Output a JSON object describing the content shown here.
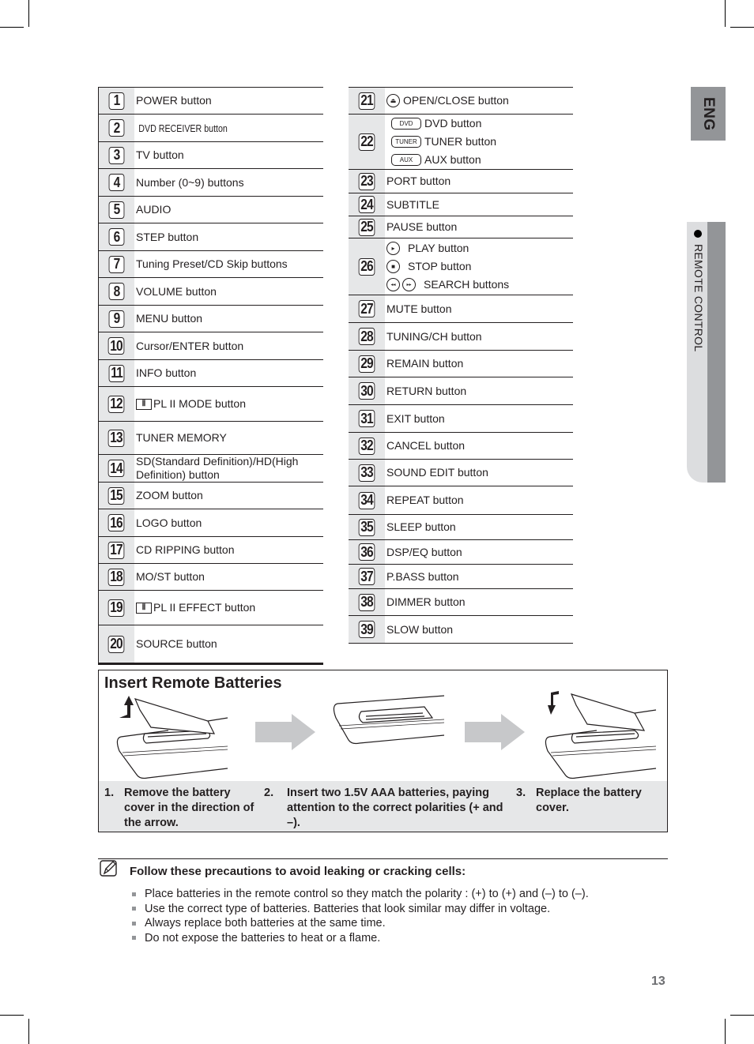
{
  "side_tabs": {
    "language": "ENG",
    "section": "REMOTE CONTROL"
  },
  "left_table": [
    {
      "num": "1",
      "label": "POWER button"
    },
    {
      "num": "2",
      "label": "DVD RECEIVER button",
      "narrow": true
    },
    {
      "num": "3",
      "label": "TV button"
    },
    {
      "num": "4",
      "label": "Number (0~9) buttons"
    },
    {
      "num": "5",
      "label": "AUDIO"
    },
    {
      "num": "6",
      "label": "STEP button"
    },
    {
      "num": "7",
      "label": "Tuning Preset/CD Skip buttons"
    },
    {
      "num": "8",
      "label": "VOLUME button"
    },
    {
      "num": "9",
      "label": "MENU button"
    },
    {
      "num": "10",
      "label": "Cursor/ENTER button"
    },
    {
      "num": "11",
      "label": "INFO button"
    },
    {
      "num": "12",
      "label": "PL II MODE button",
      "icon": "dolby-icon"
    },
    {
      "num": "13",
      "label": "TUNER MEMORY"
    },
    {
      "num": "14",
      "label": "SD(Standard Definition)/HD(High Definition) button"
    },
    {
      "num": "15",
      "label": "ZOOM button"
    },
    {
      "num": "16",
      "label": "LOGO button"
    },
    {
      "num": "17",
      "label": "CD RIPPING  button"
    },
    {
      "num": "18",
      "label": "MO/ST button"
    },
    {
      "num": "19",
      "label": "PL II EFFECT button",
      "icon": "dolby-icon"
    },
    {
      "num": "20",
      "label": "SOURCE button"
    }
  ],
  "right_table": [
    {
      "num": "21",
      "lines": [
        {
          "icon": "eject-icon",
          "label": "OPEN/CLOSE button"
        }
      ]
    },
    {
      "num": "22",
      "lines": [
        {
          "pill": "DVD",
          "label": "DVD button"
        },
        {
          "pill": "TUNER",
          "label": "TUNER button"
        },
        {
          "pill": "AUX",
          "label": "AUX button"
        }
      ]
    },
    {
      "num": "23",
      "lines": [
        {
          "label": "PORT button"
        }
      ]
    },
    {
      "num": "24",
      "lines": [
        {
          "label": "SUBTITLE"
        }
      ]
    },
    {
      "num": "25",
      "lines": [
        {
          "label": "PAUSE button"
        }
      ]
    },
    {
      "num": "26",
      "lines": [
        {
          "icon": "play-icon",
          "label": "PLAY button"
        },
        {
          "icon": "stop-icon",
          "label": "STOP button"
        },
        {
          "icon": "search-icons",
          "label": "SEARCH buttons"
        }
      ]
    },
    {
      "num": "27",
      "lines": [
        {
          "label": "MUTE button"
        }
      ]
    },
    {
      "num": "28",
      "lines": [
        {
          "label": "TUNING/CH button"
        }
      ]
    },
    {
      "num": "29",
      "lines": [
        {
          "label": "REMAIN button"
        }
      ]
    },
    {
      "num": "30",
      "lines": [
        {
          "label": "RETURN button"
        }
      ]
    },
    {
      "num": "31",
      "lines": [
        {
          "label": "EXIT button"
        }
      ]
    },
    {
      "num": "32",
      "lines": [
        {
          "label": "CANCEL button"
        }
      ]
    },
    {
      "num": "33",
      "lines": [
        {
          "label": "SOUND EDIT button"
        }
      ]
    },
    {
      "num": "34",
      "lines": [
        {
          "label": "REPEAT button"
        }
      ]
    },
    {
      "num": "35",
      "lines": [
        {
          "label": "SLEEP button"
        }
      ]
    },
    {
      "num": "36",
      "lines": [
        {
          "label": "DSP/EQ button"
        }
      ]
    },
    {
      "num": "37",
      "lines": [
        {
          "label": "P.BASS button"
        }
      ]
    },
    {
      "num": "38",
      "lines": [
        {
          "label": "DIMMER button"
        }
      ]
    },
    {
      "num": "39",
      "lines": [
        {
          "label": "SLOW button"
        }
      ]
    }
  ],
  "batteries": {
    "title": "Insert Remote Batteries",
    "steps": [
      {
        "num": "1.",
        "text": "Remove the battery cover in the direction of the arrow."
      },
      {
        "num": "2.",
        "text": "Insert two 1.5V AAA batteries, paying attention to the correct polarities (+ and –)."
      },
      {
        "num": "3.",
        "text": "Replace the battery cover."
      }
    ]
  },
  "precautions": {
    "title": "Follow these precautions to avoid leaking or cracking cells:",
    "items": [
      "Place batteries in the remote control so they match the polarity : (+) to (+) and (–) to (–).",
      "Use the correct type of batteries. Batteries that look similar may differ in voltage.",
      "Always replace both batteries at the same time.",
      "Do not expose the batteries to heat or a flame."
    ]
  },
  "page_number": "13"
}
